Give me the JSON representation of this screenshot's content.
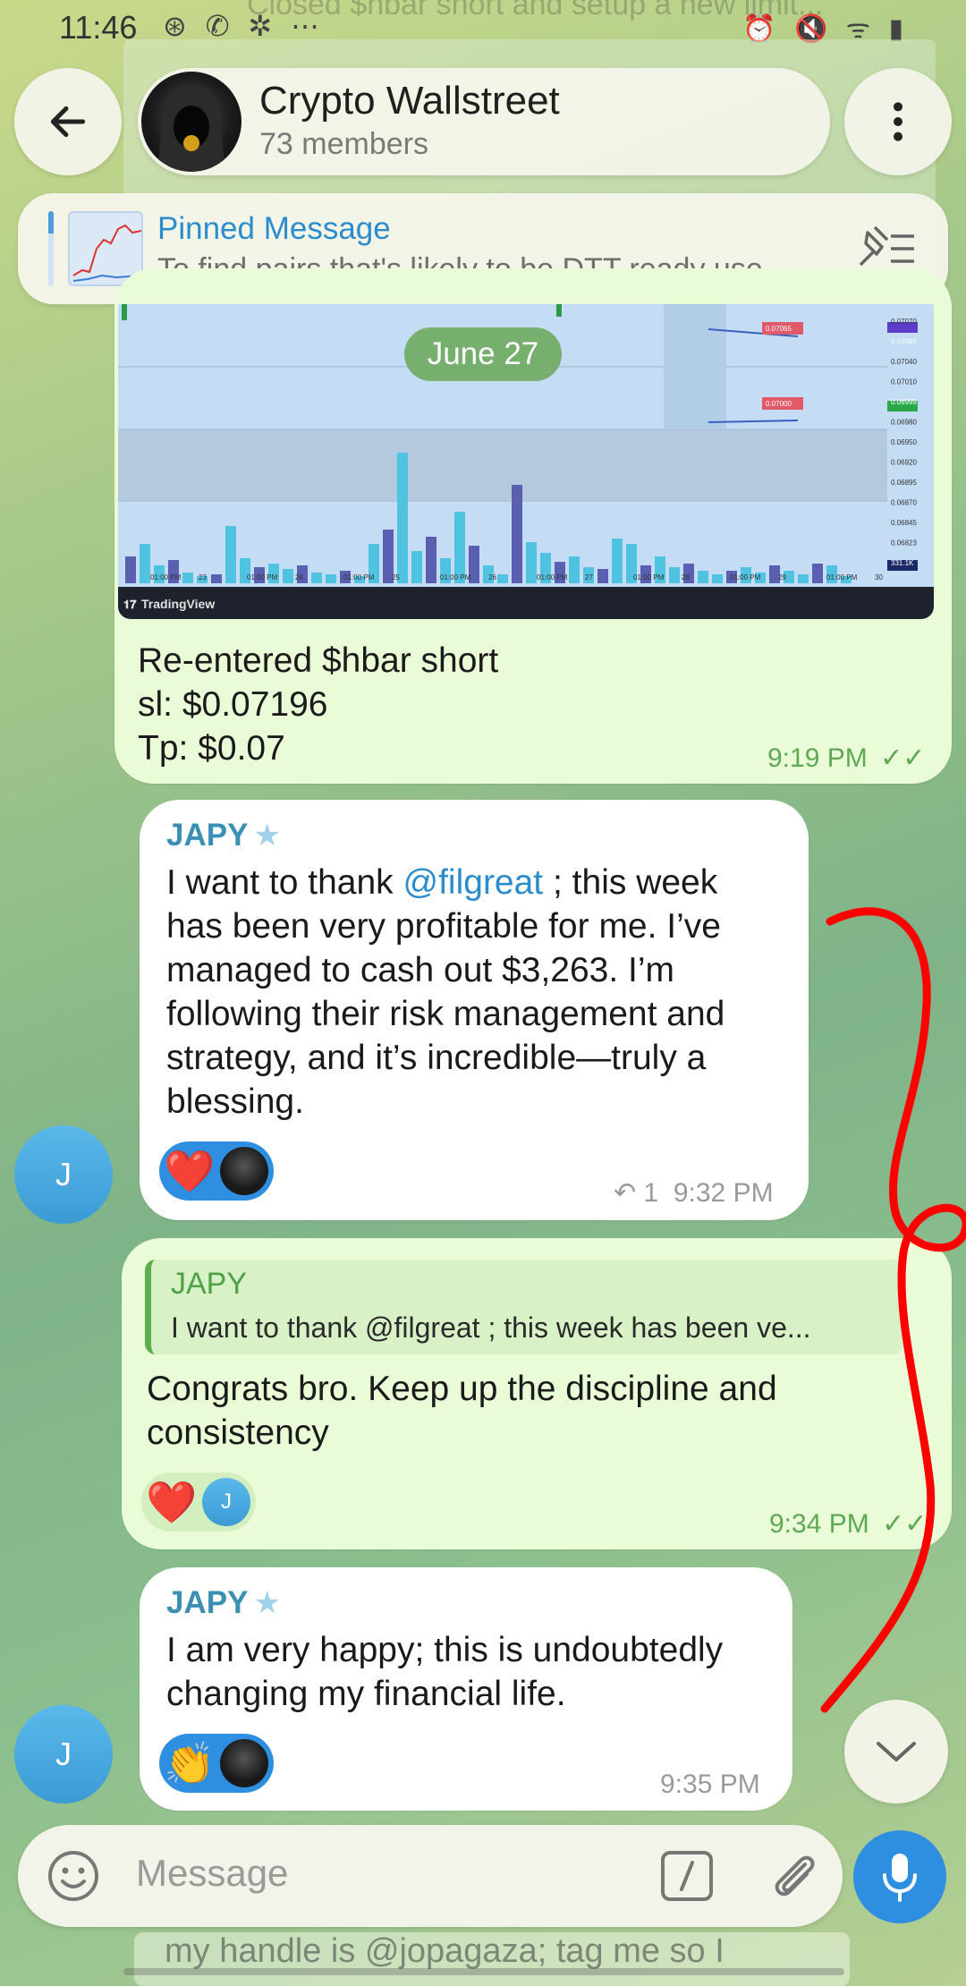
{
  "status_bar": {
    "time": "11:46",
    "icons": "⊛ ✆ ✲ ⋯",
    "ghost_text": "Closed $hbar short and setup a new limit...",
    "right_icons": "⏰ 🔇 ᯤ ▮"
  },
  "header": {
    "title": "Crypto Wallstreet",
    "subtitle": "73 members"
  },
  "pinned": {
    "title": "Pinned Message",
    "text": "To find pairs that's likely to be DTT ready use..."
  },
  "date_pill": "June 27",
  "chart_image": {
    "price_labels": [
      "0.07070",
      "0.07061",
      "0.07040",
      "0.07010",
      "0.06999",
      "0.06980",
      "0.06950",
      "0.06920",
      "0.06895",
      "0.06870",
      "0.06845",
      "0.06823",
      "331.1K"
    ],
    "date_labels": [
      "01:00 PM",
      "23",
      "01:00 PM",
      "24",
      "01:00 PM",
      "25",
      "01:00 PM",
      "26",
      "01:00 PM",
      "27",
      "01:00 PM",
      "28",
      "01:00 PM",
      "29",
      "01:00 PM",
      "30"
    ],
    "tags": [
      "0.07065",
      "0.07000"
    ],
    "brand": "TradingView"
  },
  "messages": [
    {
      "type": "out",
      "lines": [
        "Re-entered $hbar short",
        "sl: $0.07196",
        "Tp: $0.07"
      ],
      "time": "9:19 PM"
    },
    {
      "type": "in",
      "sender": "JAPY",
      "lines": [
        "I want to thank ",
        "@filgreat",
        " ; this week",
        "has been very profitable for me. I’ve",
        "managed to cash out $3,263. I’m",
        "following their risk management and",
        "strategy, and it’s incredible—truly a",
        "blessing."
      ],
      "reaction": "❤️",
      "reply_count": "1",
      "time": "9:32 PM",
      "avatar_letter": "J"
    },
    {
      "type": "out",
      "reply_to": {
        "name": "JAPY",
        "text": "I want to thank @filgreat ; this week has been ve..."
      },
      "lines": [
        "Congrats bro. Keep up the discipline and",
        "consistency"
      ],
      "reaction": "❤️",
      "reaction_avatar": "J",
      "time": "9:34 PM"
    },
    {
      "type": "in",
      "sender": "JAPY",
      "lines": [
        "I am very happy; this is undoubtedly",
        "changing my financial life."
      ],
      "reaction": "👏",
      "time": "9:35 PM",
      "avatar_letter": "J"
    }
  ],
  "input": {
    "placeholder": "Message"
  },
  "ghost_bottom": "my handle is @jopagaza; tag me so I",
  "colors": {
    "accent": "#2e8fe0",
    "out_bubble": "#e9fbd7",
    "in_bubble": "#ffffff",
    "sender": "#3b8fb4",
    "annotation": "#ff0000"
  }
}
